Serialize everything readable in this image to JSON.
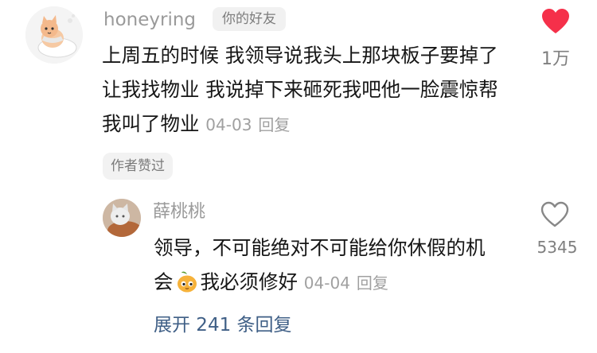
{
  "comment": {
    "username": "honeyring",
    "badge": "你的好友",
    "text": "上周五的时候 我领导说我头上那块板子要掉了让我找物业 我说掉下来砸死我吧他一脸震惊帮我叫了物业",
    "date": "04-03",
    "reply_label": "回复",
    "author_liked": "作者赞过",
    "like_count": "1万",
    "liked": true,
    "heart_color": "#f5304a"
  },
  "reply": {
    "username": "薛桃桃",
    "text_before_emoji": "领导，不可能绝对不可能给你休假的机会",
    "text_after_emoji": "我必须修好",
    "emoji_icon": "orange-fruit-emoji",
    "date": "04-04",
    "reply_label": "回复",
    "like_count": "5345",
    "liked": false
  },
  "expand_replies": "展开 241 条回复",
  "colors": {
    "link": "#3f5f86",
    "meta": "#a0a0a0"
  }
}
